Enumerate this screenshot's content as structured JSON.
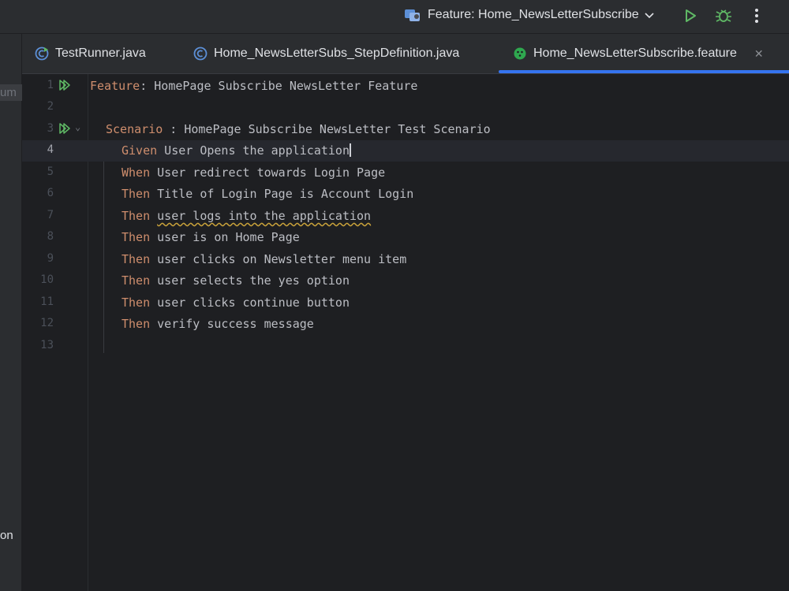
{
  "toolbar": {
    "run_config_label": "Feature: Home_NewsLetterSubscribe",
    "run_icon": "run-icon",
    "debug_icon": "debug-icon",
    "more_icon": "more-icon"
  },
  "left_strip": {
    "top_label": "um",
    "bottom_label": "on"
  },
  "tabs": [
    {
      "label": "TestRunner.java",
      "icon": "java-class-run-icon"
    },
    {
      "label": "Home_NewsLetterSubs_StepDefinition.java",
      "icon": "java-class-icon"
    },
    {
      "label": "Home_NewsLetterSubscribe.feature",
      "icon": "cucumber-icon",
      "active": true
    }
  ],
  "colors": {
    "accent": "#3574f0",
    "keyword": "#cf8e6d",
    "text": "#bcbec4",
    "run_green": "#5fb865"
  },
  "editor": {
    "lines": [
      {
        "n": "1",
        "kw": "Feature",
        "rest": ": HomePage Subscribe NewsLetter Feature"
      },
      {
        "n": "2",
        "kw": "",
        "rest": ""
      },
      {
        "n": "3",
        "kw": "Scenario",
        "rest": " : HomePage Subscribe NewsLetter Test Scenario"
      },
      {
        "n": "4",
        "kw": "Given",
        "rest": " User Opens the application"
      },
      {
        "n": "5",
        "kw": "When",
        "rest": " User redirect towards Login Page"
      },
      {
        "n": "6",
        "kw": "Then",
        "rest": " Title of Login Page is Account Login"
      },
      {
        "n": "7",
        "kw": "Then",
        "rest": " ",
        "underlined": "user logs into the application"
      },
      {
        "n": "8",
        "kw": "Then",
        "rest": " user is on Home Page"
      },
      {
        "n": "9",
        "kw": "Then",
        "rest": " user clicks on Newsletter menu item"
      },
      {
        "n": "10",
        "kw": "Then",
        "rest": " user selects the yes option"
      },
      {
        "n": "11",
        "kw": "Then",
        "rest": " user clicks continue button"
      },
      {
        "n": "12",
        "kw": "Then",
        "rest": " verify success message"
      },
      {
        "n": "13",
        "kw": "",
        "rest": ""
      }
    ]
  }
}
